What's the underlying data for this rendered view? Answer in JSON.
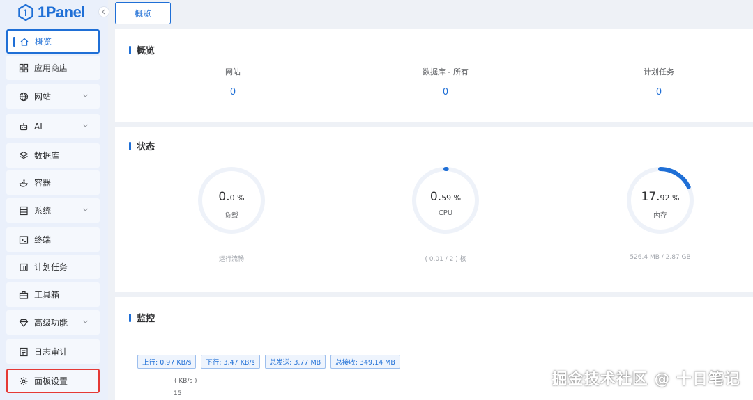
{
  "app": {
    "logo_text": "1Panel"
  },
  "sidebar": {
    "items": [
      {
        "label": "概览",
        "icon": "home-icon",
        "active": true
      },
      {
        "label": "应用商店",
        "icon": "grid-icon"
      },
      {
        "label": "网站",
        "icon": "globe-icon",
        "expandable": true
      },
      {
        "label": "AI",
        "icon": "robot-icon",
        "expandable": true
      },
      {
        "label": "数据库",
        "icon": "layers-icon"
      },
      {
        "label": "容器",
        "icon": "whale-icon"
      },
      {
        "label": "系统",
        "icon": "server-icon",
        "expandable": true
      },
      {
        "label": "终端",
        "icon": "terminal-icon"
      },
      {
        "label": "计划任务",
        "icon": "calendar-icon"
      },
      {
        "label": "工具箱",
        "icon": "toolbox-icon"
      },
      {
        "label": "高级功能",
        "icon": "diamond-icon",
        "expandable": true
      },
      {
        "label": "日志审计",
        "icon": "log-icon"
      },
      {
        "label": "面板设置",
        "icon": "gear-icon",
        "highlighted": true
      }
    ]
  },
  "tabs": [
    {
      "label": "概览"
    }
  ],
  "overview": {
    "title": "概览",
    "stats": [
      {
        "label": "网站",
        "value": "0"
      },
      {
        "label": "数据库 - 所有",
        "value": "0"
      },
      {
        "label": "计划任务",
        "value": "0"
      }
    ]
  },
  "status": {
    "title": "状态",
    "gauges": [
      {
        "int": "0.",
        "dec": "0 %",
        "name": "负载",
        "sub": "运行流畅",
        "percent": 0
      },
      {
        "int": "0.",
        "dec": "59 %",
        "name": "CPU",
        "sub": "( 0.01 / 2 ) 核",
        "percent": 0.59
      },
      {
        "int": "17.",
        "dec": "92 %",
        "name": "内存",
        "sub": "526.4 MB / 2.87 GB",
        "percent": 17.92
      }
    ]
  },
  "monitor": {
    "title": "监控",
    "tags": [
      {
        "text": "上行: 0.97 KB/s"
      },
      {
        "text": "下行: 3.47 KB/s"
      },
      {
        "text": "总发送: 3.77 MB"
      },
      {
        "text": "总接收: 349.14 MB"
      }
    ],
    "unit": "( KB/s )",
    "first_tick": "15"
  },
  "watermark": "掘金技术社区 @ 十日笔记",
  "colors": {
    "accent": "#1f6fd6",
    "highlight": "#e53935",
    "track": "#eef2f9"
  }
}
